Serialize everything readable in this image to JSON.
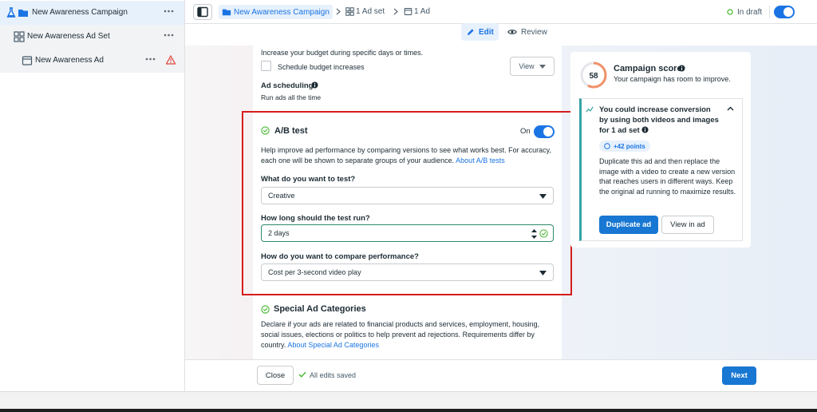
{
  "sidebar": {
    "campaign": {
      "label": "New Awareness Campaign",
      "icon": "folder-icon"
    },
    "adset": {
      "label": "New Awareness Ad Set",
      "icon": "grid-icon"
    },
    "ad": {
      "label": "New Awareness Ad",
      "icon": "ad-icon"
    }
  },
  "topbar": {
    "campaign_chip": "New Awareness Campaign",
    "adset_crumb": "1 Ad set",
    "ad_crumb": "1 Ad",
    "status": "In draft"
  },
  "tabs": {
    "edit": "Edit",
    "review": "Review"
  },
  "budget": {
    "description": "Increase your budget during specific days or times.",
    "schedule_label": "Schedule budget increases",
    "view_label": "View"
  },
  "scheduling": {
    "title": "Ad scheduling",
    "value": "Run ads all the time"
  },
  "ab_test": {
    "title": "A/B test",
    "toggle_label": "On",
    "description": "Help improve ad performance by comparing versions to see what works best. For accuracy, each one will be shown to separate groups of your audience.",
    "link": "About A/B tests",
    "q1_label": "What do you want to test?",
    "q1_value": "Creative",
    "q2_label": "How long should the test run?",
    "q2_value": "2 days",
    "q3_label": "How do you want to compare performance?",
    "q3_value": "Cost per 3-second video play"
  },
  "special": {
    "title": "Special Ad Categories",
    "description": "Declare if your ads are related to financial products and services, employment, housing, social issues, elections or politics to help prevent ad rejections. Requirements differ by country.",
    "link": "About Special Ad Categories"
  },
  "score": {
    "value": "58",
    "fraction": 0.58,
    "title": "Campaign score",
    "subtitle": "Your campaign has room to improve.",
    "tip_title": "You could increase conversion by using both videos and images for 1 ad set",
    "points": "+42 points",
    "tip_body": "Duplicate this ad and then replace the image with a video to create a new version that reaches users in different ways. Keep the original ad running to maximize results.",
    "duplicate_label": "Duplicate ad",
    "view_label": "View in ad"
  },
  "footer": {
    "close": "Close",
    "saved": "All edits saved",
    "next": "Next"
  },
  "colors": {
    "accent": "#1b74e4",
    "primary_button": "#1877d2",
    "highlight_box": "#d61c1c",
    "success": "#42b72a",
    "warning": "#e0443a"
  }
}
